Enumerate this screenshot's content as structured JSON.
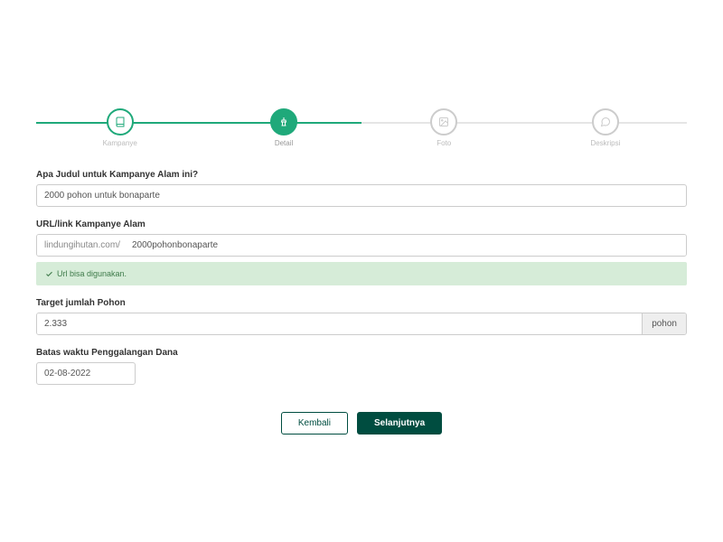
{
  "stepper": {
    "steps": [
      {
        "label": "Kampanye",
        "state": "completed"
      },
      {
        "label": "Detail",
        "state": "active"
      },
      {
        "label": "Foto",
        "state": "pending"
      },
      {
        "label": "Deskripsi",
        "state": "pending"
      }
    ]
  },
  "form": {
    "title_label": "Apa Judul untuk Kampanye Alam ini?",
    "title_value": "2000 pohon untuk bonaparte",
    "url_label": "URL/link Kampanye Alam",
    "url_prefix": "lindungihutan.com/",
    "url_value": "2000pohonbonaparte",
    "url_feedback": "Url bisa digunakan.",
    "target_label": "Target jumlah Pohon",
    "target_value": "2.333",
    "target_suffix": "pohon",
    "deadline_label": "Batas waktu Penggalangan Dana",
    "deadline_value": "02-08-2022"
  },
  "buttons": {
    "back": "Kembali",
    "next": "Selanjutnya"
  }
}
